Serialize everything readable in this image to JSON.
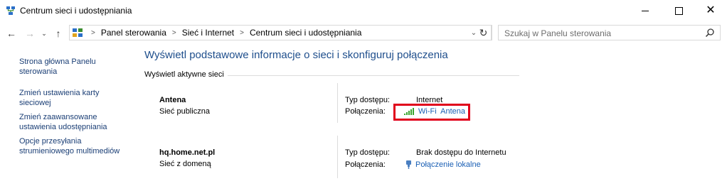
{
  "window": {
    "title": "Centrum sieci i udostępniania",
    "icon": "network-center-icon",
    "controls": {
      "minimize": "minimize-icon",
      "maximize": "maximize-icon",
      "close": "close-icon"
    }
  },
  "navigation": {
    "breadcrumbs": [
      "Panel sterowania",
      "Sieć i Internet",
      "Centrum sieci i udostępniania"
    ],
    "search_placeholder": "Szukaj w Panelu sterowania"
  },
  "sidebar": {
    "links": [
      {
        "label": "Strona główna Panelu sterowania"
      },
      {
        "label": "Zmień ustawienia karty sieciowej"
      },
      {
        "label": "Zmień zaawansowane ustawienia udostępniania"
      },
      {
        "label": "Opcje przesyłania strumieniowego multimediów"
      }
    ]
  },
  "main": {
    "heading": "Wyświetl podstawowe informacje o sieci i skonfiguruj połączenia",
    "active_networks_label": "Wyświetl aktywne sieci",
    "networks": [
      {
        "name": "Antena",
        "category": "Sieć publiczna",
        "access_type_label": "Typ dostępu:",
        "access_type": "Internet",
        "connections_label": "Połączenia:",
        "connection": "Wi-Fi  Antena",
        "connection_icon": "wifi-signal-icon",
        "highlighted": true,
        "highlight_color": "#e0001b"
      },
      {
        "name": "hq.home.net.pl",
        "category": "Sieć z domeną",
        "access_type_label": "Typ dostępu:",
        "access_type": "Brak dostępu do Internetu",
        "connections_label": "Połączenia:",
        "connection": "Połączenie lokalne",
        "connection_icon": "ethernet-icon"
      }
    ]
  },
  "colors": {
    "link": "#1a5fb4",
    "heading": "#1e4e8c",
    "highlight": "#e0001b"
  }
}
